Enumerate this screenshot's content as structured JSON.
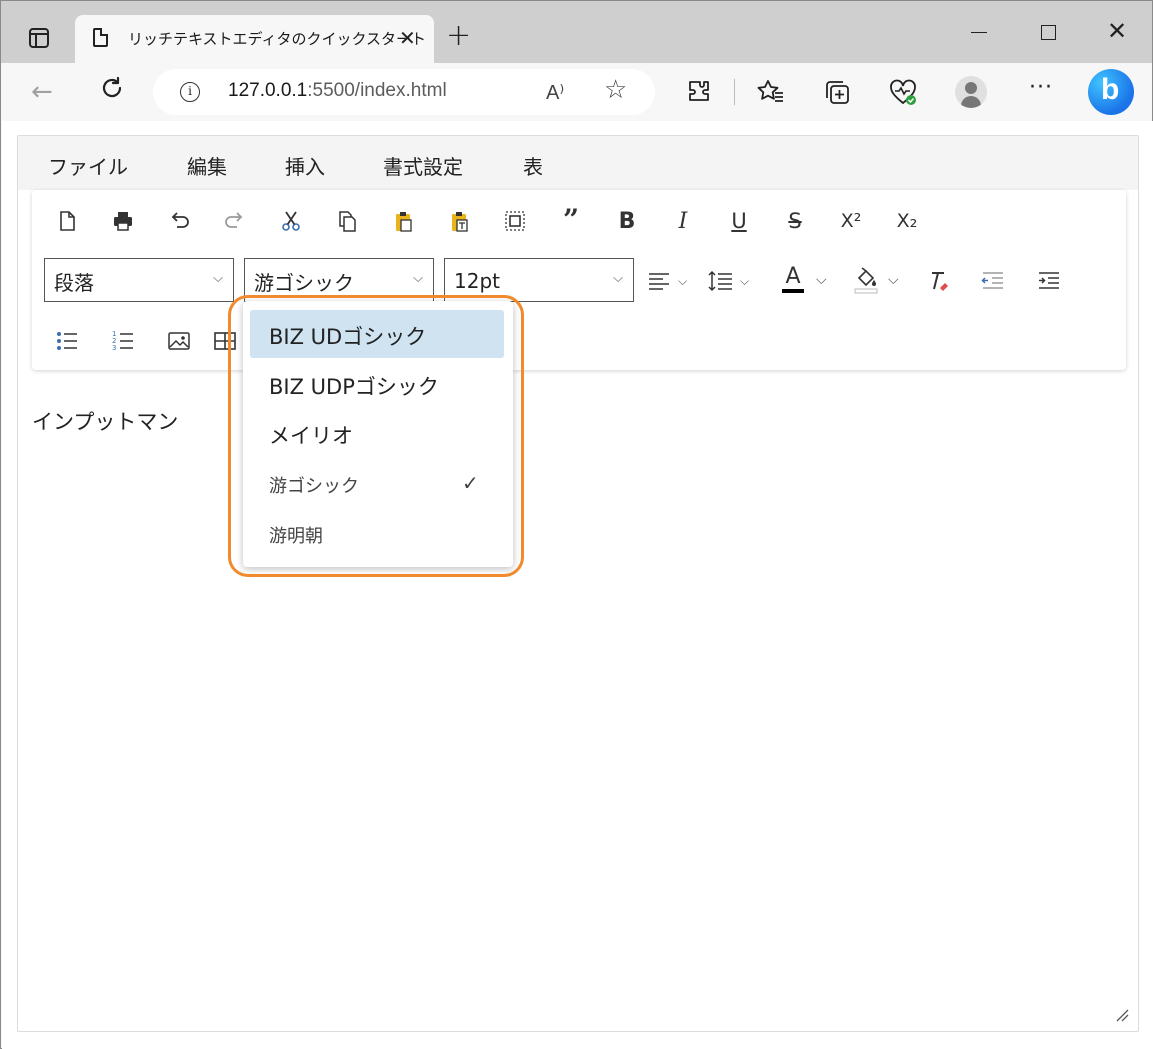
{
  "browser": {
    "tab_title": "リッチテキストエディタのクイックスタート",
    "tab_close": "✕",
    "new_tab": "+",
    "url_host": "127.0.0.1",
    "url_rest": ":5500/index.html",
    "read_aloud": "A⁾",
    "window_close": "✕"
  },
  "menu": {
    "items": [
      "ファイル",
      "編集",
      "挿入",
      "書式設定",
      "表"
    ]
  },
  "toolbar": {
    "block_format": "段落",
    "font_family": "游ゴシック",
    "font_size": "12pt",
    "icons": {
      "bold": "B",
      "italic": "I",
      "underline": "U",
      "strikethrough": "S",
      "superscript": "X²",
      "subscript": "X₂",
      "blockquote": "”",
      "font_color": "A"
    }
  },
  "editor": {
    "content": "インプットマン"
  },
  "font_dropdown": {
    "options": [
      {
        "label": "BIZ UDゴシック",
        "highlighted": true,
        "checked": false
      },
      {
        "label": "BIZ UDPゴシック",
        "highlighted": false,
        "checked": false
      },
      {
        "label": "メイリオ",
        "highlighted": false,
        "checked": false
      },
      {
        "label": "游ゴシック",
        "highlighted": false,
        "checked": true
      },
      {
        "label": "游明朝",
        "highlighted": false,
        "checked": false
      }
    ],
    "check_mark": "✓"
  },
  "colors": {
    "highlight_border": "#f08a2c",
    "selected_option_bg": "#cfe3f1",
    "paste_icon": "#e8b31d",
    "font_color_bar": "#000000",
    "clear_format_accent": "#e04b4b"
  }
}
